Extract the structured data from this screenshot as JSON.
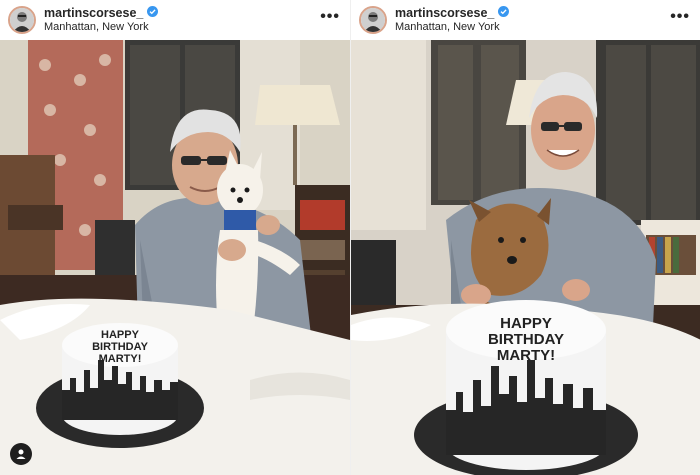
{
  "posts": [
    {
      "username": "martinscorsese_",
      "location": "Manhattan, New York",
      "more_label": "•••",
      "cake_text": "HAPPY BIRTHDAY MARTY!",
      "cake_lines": [
        "HAPPY",
        "BIRTHDAY",
        "MARTY!"
      ],
      "dog": "white pomeranian"
    },
    {
      "username": "martinscorsese_",
      "location": "Manhattan, New York",
      "more_label": "•••",
      "cake_text": "HAPPY BIRTHDAY MARTY!",
      "cake_lines": [
        "HAPPY",
        "BIRTHDAY",
        "MARTY!"
      ],
      "dog": "brown terrier"
    }
  ],
  "colors": {
    "verified": "#3897f0",
    "wall": "#d9d3c5",
    "tablecloth": "#f3f1ec",
    "shirt": "#8d97a3",
    "cake_base": "#2a2a2a"
  },
  "icons": [
    "verified-badge-icon",
    "more-options-icon",
    "tagged-user-icon"
  ]
}
